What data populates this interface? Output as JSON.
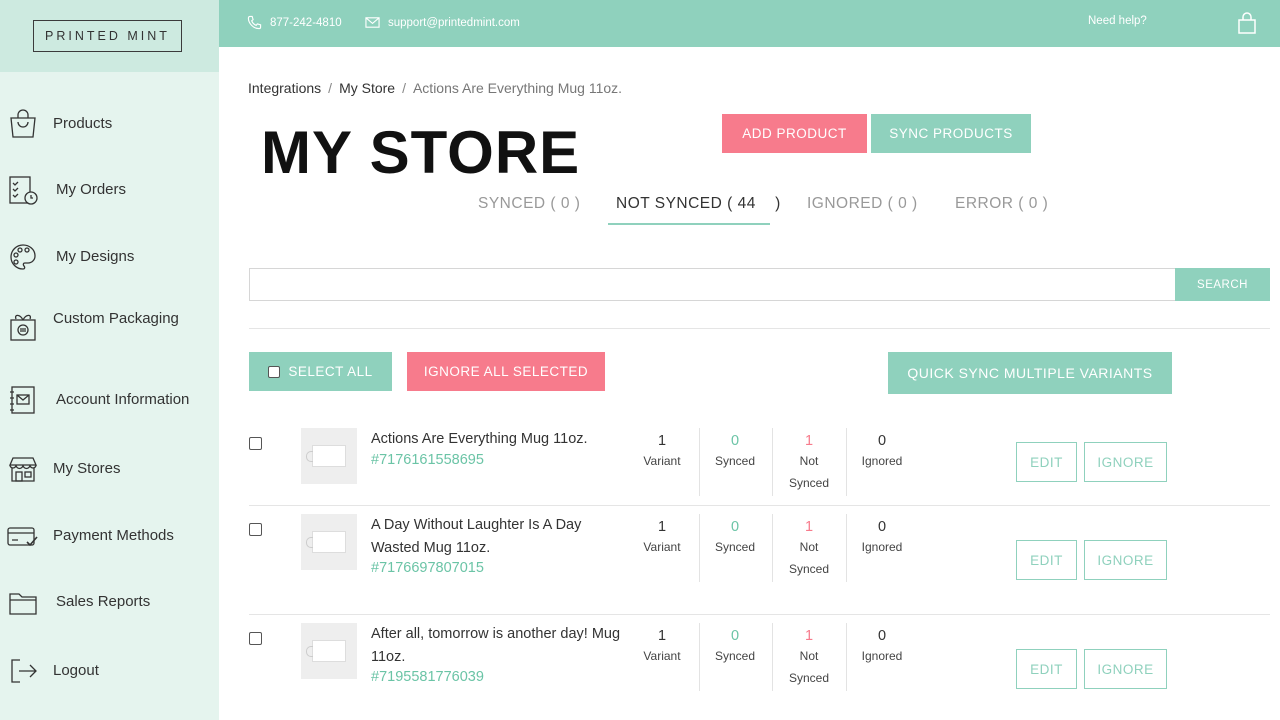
{
  "brand": {
    "logo_text": "PRINTED MINT"
  },
  "topbar": {
    "phone": "877-242-4810",
    "email": "support@printedmint.com",
    "help": "Need help?"
  },
  "sidebar": {
    "items": [
      {
        "label": "Products",
        "icon": "shopping-bag-icon"
      },
      {
        "label": "My Orders",
        "icon": "checklist-clock-icon"
      },
      {
        "label": "My Designs",
        "icon": "palette-icon"
      },
      {
        "label": "Custom Packaging",
        "icon": "gift-box-icon"
      },
      {
        "label": "Account Information",
        "icon": "address-book-icon"
      },
      {
        "label": "My Stores",
        "icon": "storefront-icon"
      },
      {
        "label": "Payment Methods",
        "icon": "credit-card-icon"
      },
      {
        "label": "Sales Reports",
        "icon": "folder-icon"
      },
      {
        "label": "Logout",
        "icon": "logout-icon"
      }
    ]
  },
  "breadcrumb": [
    "Integrations",
    "My Store",
    "Actions Are Everything Mug 11oz."
  ],
  "page_title": "MY STORE",
  "actions": {
    "add_product": "ADD PRODUCT",
    "sync_products": "SYNC PRODUCTS"
  },
  "tabs": [
    {
      "label": "SYNCED ( 0 )",
      "active": false
    },
    {
      "label": "NOT SYNCED ( 44    )",
      "active": true
    },
    {
      "label": "IGNORED ( 0 )",
      "active": false
    },
    {
      "label": "ERROR ( 0 )",
      "active": false
    }
  ],
  "search": {
    "value": "",
    "button": "SEARCH"
  },
  "bulk": {
    "select_all": "SELECT ALL",
    "ignore_all": "IGNORE ALL SELECTED",
    "quick_sync": "QUICK SYNC MULTIPLE VARIANTS"
  },
  "stat_labels": {
    "variant": "Variant",
    "synced": "Synced",
    "not": "Not",
    "not2": "Synced",
    "ignored": "Ignored"
  },
  "row_buttons": {
    "edit": "EDIT",
    "ignore": "IGNORE"
  },
  "products": [
    {
      "title": "Actions Are Everything Mug 11oz.",
      "id": "#7176161558695",
      "variants": "1",
      "synced": "0",
      "not_synced": "1",
      "ignored": "0"
    },
    {
      "title": "A Day Without Laughter Is A Day Wasted Mug 11oz.",
      "id": "#7176697807015",
      "variants": "1",
      "synced": "0",
      "not_synced": "1",
      "ignored": "0"
    },
    {
      "title": "After all, tomorrow is another day! Mug 11oz.",
      "id": "#7195581776039",
      "variants": "1",
      "synced": "0",
      "not_synced": "1",
      "ignored": "0"
    }
  ],
  "colors": {
    "mint": "#8fd1bd",
    "pink": "#f77b8c",
    "sidebar": "#e5f4ee",
    "link": "#6bc4a6"
  }
}
